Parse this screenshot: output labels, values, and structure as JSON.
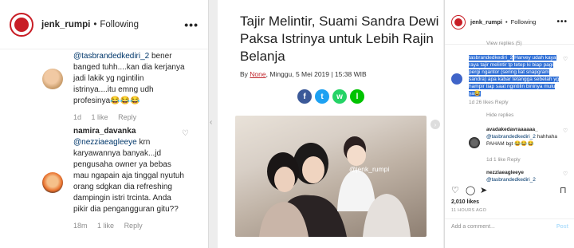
{
  "left_panel": {
    "header": {
      "username": "jenk_rumpi",
      "separator": "•",
      "follow": "Following",
      "more": "•••"
    },
    "comments": [
      {
        "mention": "@tasbrandedkediri_2",
        "text": "bener banged tuhh....kan dia kerjanya jadi lakik yg ngintilin istrinya....itu emng udh profesinya😂😂😂",
        "time": "1d",
        "likes": "1 like",
        "reply": "Reply"
      },
      {
        "user": "namira_davanka",
        "mention": "@nezziaeagleeye",
        "text": "krn karyawannya banyak...jd pengusaha owner ya bebas mau ngapain aja tinggal nyutuh orang sdgkan dia refreshing dampingin istri trcinta. Anda pikir dia pengangguran gitu??",
        "time": "18m",
        "likes": "1 like",
        "reply": "Reply"
      }
    ]
  },
  "article": {
    "title": "Tajir Melintir, Suami Sandra Dewi Paksa Istrinya untuk Lebih Rajin Belanja",
    "by": "By",
    "author": "None",
    "date": ", Minggu, 5 Mei 2019 | 15:38 WIB",
    "share": [
      "f",
      "t",
      "w",
      "l"
    ],
    "watermark": "@jenk_rumpi"
  },
  "right_panel": {
    "header": {
      "username": "jenk_rumpi",
      "separator": "•",
      "follow": "Following",
      "more": "•••"
    },
    "view_replies": "View replies (5)",
    "selected_comment": {
      "mention": "tasbrandedkediri_2",
      "text": "Harvey udah kaya raya tajir melintir tp tetep ki biap pagi pergi ngantor (sering liat snapgram sandra) apa kabar tetangga sebelah yg hampir tiap saat ngintilin bininya mulu ya😂",
      "meta": "1d  26 likes  Reply"
    },
    "hide_replies": "Hide replies",
    "reply1": {
      "user": "avadakedavraaaaaa_",
      "mention": "@tasbrandedkediri_2",
      "text": "hahhaha PAHAM bgt 😂😂😂",
      "meta": "1d  1 like  Reply"
    },
    "reply2": {
      "user": "nezziaeagleeye",
      "mention": "@tasbrandedkediri_2"
    },
    "likes": "2,010 likes",
    "time_ago": "11 HOURS AGO",
    "add_comment": "Add a comment...",
    "post": "Post"
  },
  "colors": {
    "accent_red": "#c81d25",
    "link": "#00376b",
    "selection": "#2f6fd6"
  },
  "icons": [
    "heart-icon",
    "comment-icon",
    "share-icon",
    "bookmark-icon",
    "more-icon",
    "chevron-right-icon",
    "chevron-left-icon"
  ]
}
